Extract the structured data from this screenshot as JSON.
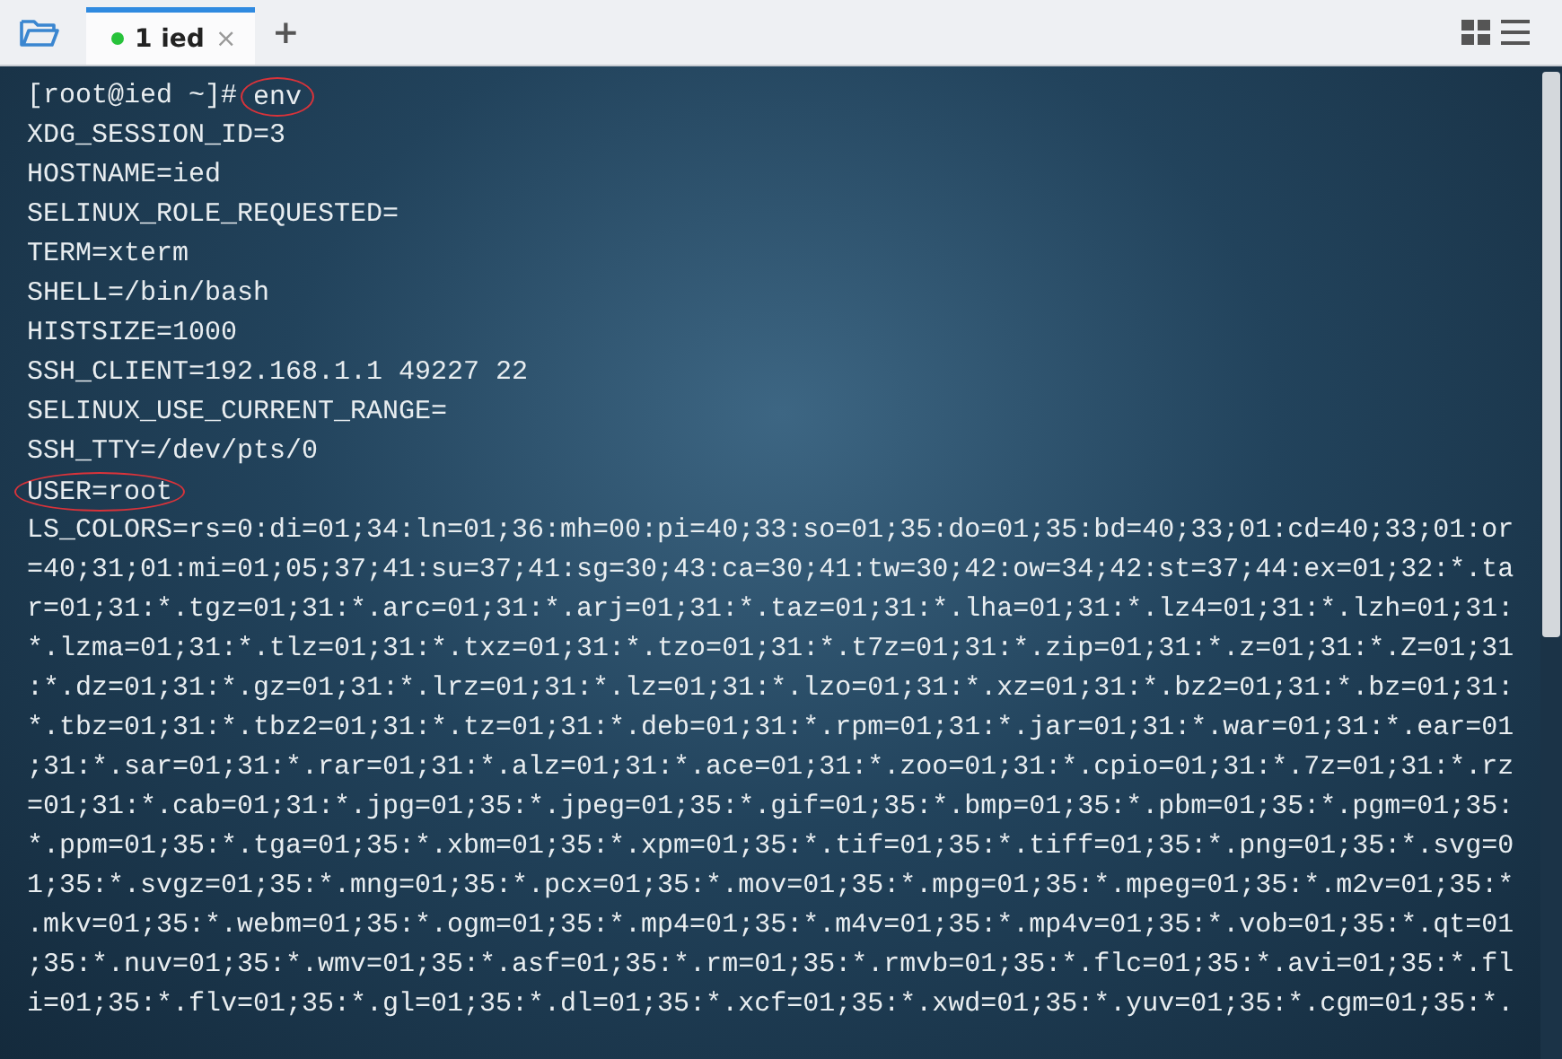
{
  "tabs": [
    {
      "label": "1 ied",
      "selected": true,
      "connected": true,
      "close": "×"
    }
  ],
  "new_tab": "+",
  "terminal": {
    "prompt": "[root@ied ~]#",
    "command": "env",
    "command_circled": true,
    "lines": [
      {
        "text": "XDG_SESSION_ID=3",
        "circled": false
      },
      {
        "text": "HOSTNAME=ied",
        "circled": false
      },
      {
        "text": "SELINUX_ROLE_REQUESTED=",
        "circled": false
      },
      {
        "text": "TERM=xterm",
        "circled": false
      },
      {
        "text": "SHELL=/bin/bash",
        "circled": false
      },
      {
        "text": "HISTSIZE=1000",
        "circled": false
      },
      {
        "text": "SSH_CLIENT=192.168.1.1 49227 22",
        "circled": false
      },
      {
        "text": "SELINUX_USE_CURRENT_RANGE=",
        "circled": false
      },
      {
        "text": "SSH_TTY=/dev/pts/0",
        "circled": false
      },
      {
        "text": "USER=root",
        "circled": true
      },
      {
        "text": "LS_COLORS=rs=0:di=01;34:ln=01;36:mh=00:pi=40;33:so=01;35:do=01;35:bd=40;33;01:cd=40;33;01:or",
        "circled": false
      },
      {
        "text": "=40;31;01:mi=01;05;37;41:su=37;41:sg=30;43:ca=30;41:tw=30;42:ow=34;42:st=37;44:ex=01;32:*.ta",
        "circled": false
      },
      {
        "text": "r=01;31:*.tgz=01;31:*.arc=01;31:*.arj=01;31:*.taz=01;31:*.lha=01;31:*.lz4=01;31:*.lzh=01;31:",
        "circled": false
      },
      {
        "text": "*.lzma=01;31:*.tlz=01;31:*.txz=01;31:*.tzo=01;31:*.t7z=01;31:*.zip=01;31:*.z=01;31:*.Z=01;31",
        "circled": false
      },
      {
        "text": ":*.dz=01;31:*.gz=01;31:*.lrz=01;31:*.lz=01;31:*.lzo=01;31:*.xz=01;31:*.bz2=01;31:*.bz=01;31:",
        "circled": false
      },
      {
        "text": "*.tbz=01;31:*.tbz2=01;31:*.tz=01;31:*.deb=01;31:*.rpm=01;31:*.jar=01;31:*.war=01;31:*.ear=01",
        "circled": false
      },
      {
        "text": ";31:*.sar=01;31:*.rar=01;31:*.alz=01;31:*.ace=01;31:*.zoo=01;31:*.cpio=01;31:*.7z=01;31:*.rz",
        "circled": false
      },
      {
        "text": "=01;31:*.cab=01;31:*.jpg=01;35:*.jpeg=01;35:*.gif=01;35:*.bmp=01;35:*.pbm=01;35:*.pgm=01;35:",
        "circled": false
      },
      {
        "text": "*.ppm=01;35:*.tga=01;35:*.xbm=01;35:*.xpm=01;35:*.tif=01;35:*.tiff=01;35:*.png=01;35:*.svg=0",
        "circled": false
      },
      {
        "text": "1;35:*.svgz=01;35:*.mng=01;35:*.pcx=01;35:*.mov=01;35:*.mpg=01;35:*.mpeg=01;35:*.m2v=01;35:*",
        "circled": false
      },
      {
        "text": ".mkv=01;35:*.webm=01;35:*.ogm=01;35:*.mp4=01;35:*.m4v=01;35:*.mp4v=01;35:*.vob=01;35:*.qt=01",
        "circled": false
      },
      {
        "text": ";35:*.nuv=01;35:*.wmv=01;35:*.asf=01;35:*.rm=01;35:*.rmvb=01;35:*.flc=01;35:*.avi=01;35:*.fl",
        "circled": false
      },
      {
        "text": "i=01;35:*.flv=01;35:*.gl=01;35:*.dl=01;35:*.xcf=01;35:*.xwd=01;35:*.yuv=01;35:*.cgm=01;35:*.",
        "circled": false
      }
    ]
  }
}
